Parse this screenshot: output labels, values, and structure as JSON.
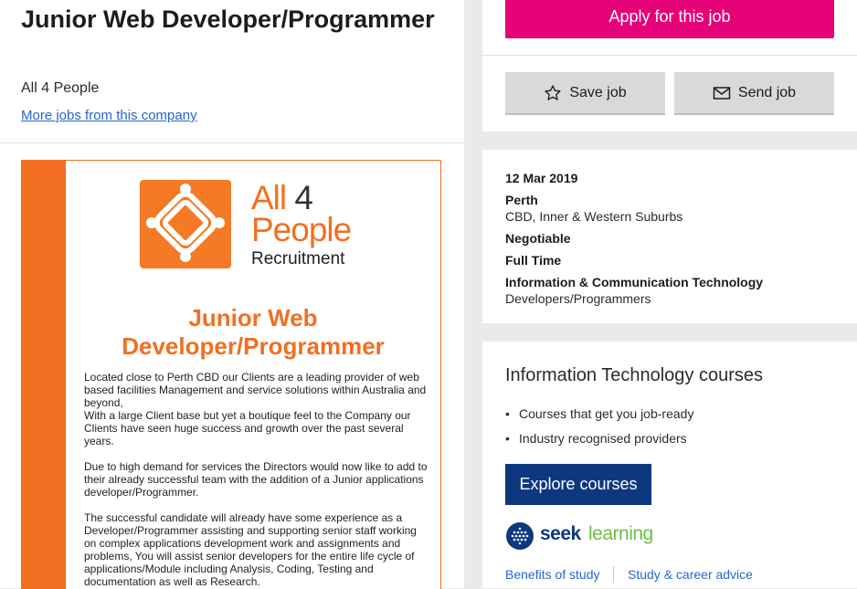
{
  "job": {
    "title": "Junior Web Developer/Programmer",
    "company": "All 4 People",
    "more_jobs_link": "More jobs from this company"
  },
  "ad": {
    "brand_line1": "All",
    "brand_num": "4",
    "brand_line2": "People",
    "brand_line3": "Recruitment",
    "title": "Junior Web Developer/Programmer",
    "paragraphs": [
      "Located close to Perth CBD our Clients are a leading provider of web based facilities Management and service solutions within Australia and beyond,\nWith a large Client base but yet a boutique feel to the Company our Clients have seen huge success and growth over the past several years.",
      "Due to high demand for services the Directors would now like to add to their already successful team with the addition of a Junior applications developer/Programmer.",
      "The successful candidate will already have some experience as a Developer/Programmer assisting and supporting senior staff working on complex applications development work and assignments and problems, You will assist senior developers for the entire life cycle of applications/Module including Analysis, Coding, Testing and documentation as well as Research."
    ]
  },
  "actions": {
    "apply_label": "Apply for this job",
    "save_label": "Save job",
    "send_label": "Send job"
  },
  "details": {
    "date": "12 Mar 2019",
    "location": "Perth",
    "area": "CBD, Inner & Western Suburbs",
    "salary": "Negotiable",
    "work_type": "Full Time",
    "classification": "Information & Communication Technology",
    "sub_classification": "Developers/Programmers"
  },
  "courses": {
    "title": "Information Technology courses",
    "bullets": [
      "Courses that get you job-ready",
      "Industry recognised providers"
    ],
    "bullet_glyph": "•",
    "explore_label": "Explore courses",
    "logo_seek": "seek",
    "logo_learning": "learning",
    "link_benefits": "Benefits of study",
    "link_advice": "Study & career advice"
  },
  "colors": {
    "apply": "#e60278",
    "brand_orange": "#f26f21",
    "link": "#2765cf",
    "explore": "#0d3880",
    "learning_green": "#6ebd45"
  },
  "icons": [
    "star-icon",
    "envelope-icon",
    "seek-globe-icon",
    "all4people-logo-icon"
  ]
}
